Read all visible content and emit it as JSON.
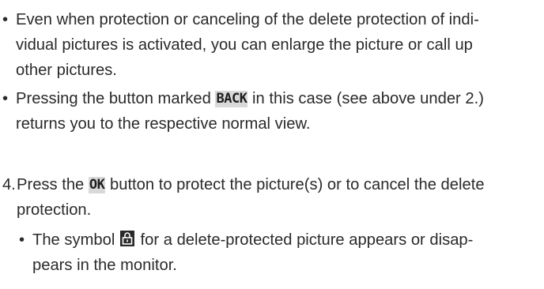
{
  "items": [
    {
      "type": "bullet",
      "marker": "•",
      "lines": [
        "Even when protection or canceling of the delete protection of indi-",
        "vidual pictures is activated, you can enlarge the picture or call up",
        "other pictures."
      ]
    },
    {
      "type": "bullet",
      "marker": "•",
      "line1_before": "Pressing the button marked ",
      "line1_key": "BACK",
      "line1_after": " in this case (see above under 2.)",
      "line2": "returns you to the respective normal view."
    },
    {
      "type": "numbered",
      "marker": "4.",
      "line1_before": "Press the ",
      "line1_key": "OK",
      "line1_after": " button to protect the picture(s) or to cancel the delete",
      "line2": "protection.",
      "sub_bullet": {
        "marker": "•",
        "line1_before": "The symbol ",
        "symbol_icon": "lock-icon",
        "line1_after": " for a delete-protected picture appears or disap-",
        "line2": "pears in the monitor."
      }
    }
  ],
  "colors": {
    "text": "#2a2a2a",
    "key_background": "#d9d9d9"
  }
}
